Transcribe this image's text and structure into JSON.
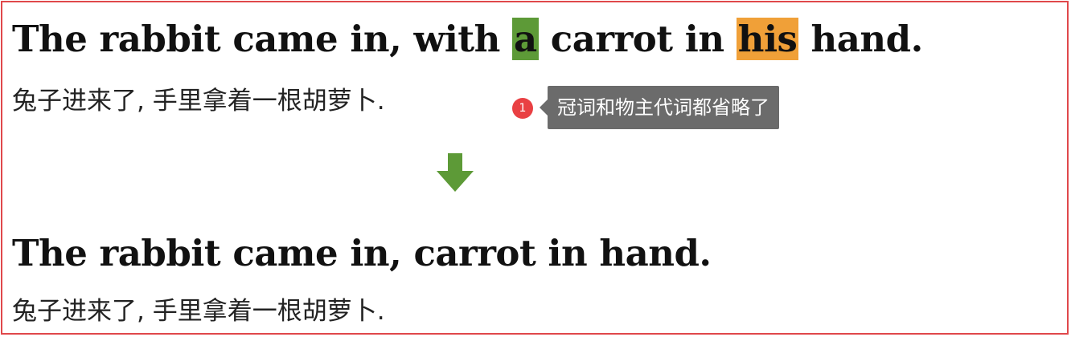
{
  "original": {
    "english_parts": [
      {
        "text": "The rabbit came in, with ",
        "highlight": null
      },
      {
        "text": "a",
        "highlight": "#5d9a37"
      },
      {
        "text": " carrot in ",
        "highlight": null
      },
      {
        "text": "his",
        "highlight": "#f0a038"
      },
      {
        "text": " hand.",
        "highlight": null
      }
    ],
    "chinese": "兔子进来了, 手里拿着一根胡萝卜."
  },
  "annotation": {
    "badge_number": "1",
    "note": "冠词和物主代词都省略了",
    "badge_color": "#e94043",
    "note_bg_color": "#6b6b6b"
  },
  "arrow": {
    "icon": "arrow-down-icon",
    "color": "#5d9a37"
  },
  "rewritten": {
    "english": "The rabbit came in, carrot in hand.",
    "chinese": "兔子进来了, 手里拿着一根胡萝卜."
  },
  "frame_color": "#e0484b"
}
